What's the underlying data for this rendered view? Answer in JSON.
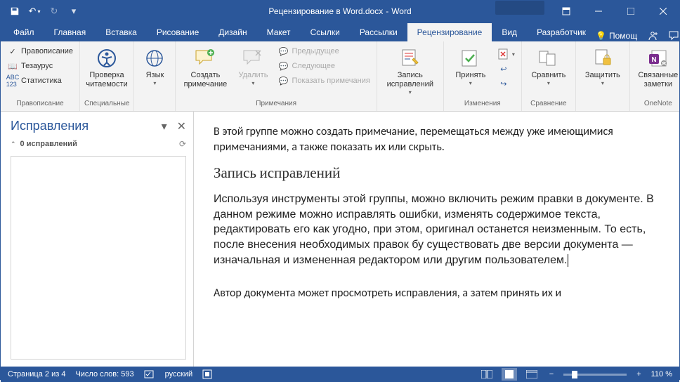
{
  "title": {
    "doc": "Рецензирование в Word.docx",
    "sep": "-",
    "app": "Word"
  },
  "tabs": [
    "Файл",
    "Главная",
    "Вставка",
    "Рисование",
    "Дизайн",
    "Макет",
    "Ссылки",
    "Рассылки",
    "Рецензирование",
    "Вид",
    "Разработчик"
  ],
  "active_tab_index": 8,
  "tell_me": "Помощ",
  "ribbon": {
    "group1": {
      "label": "Правописание",
      "spelling": "Правописание",
      "thesaurus": "Тезаурус",
      "stats": "Статистика"
    },
    "group2": {
      "label": "Специальные",
      "readability": "Проверка читаемости"
    },
    "group3": {
      "label": "",
      "language": "Язык"
    },
    "group4": {
      "label": "Примечания",
      "new_comment": "Создать примечание",
      "delete": "Удалить",
      "prev": "Предыдущее",
      "next": "Следующее",
      "show": "Показать примечания"
    },
    "group5": {
      "label": "",
      "track": "Запись исправлений"
    },
    "group6": {
      "label": "Изменения",
      "accept": "Принять"
    },
    "group7": {
      "label": "Сравнение",
      "compare": "Сравнить"
    },
    "group8": {
      "label": "",
      "protect": "Защитить"
    },
    "group9": {
      "label": "OneNote",
      "onenote": "Связанные заметки"
    }
  },
  "sidebar": {
    "title": "Исправления",
    "subcount": "0 исправлений"
  },
  "document": {
    "p1": "В этой группе можно создать примечание, перемещаться между уже имеющимися примечаниями, а также показать их или скрыть.",
    "h1": "Запись исправлений",
    "p2": "Используя инструменты этой группы, можно включить режим правки в документе. В данном режиме можно исправлять ошибки, изменять содержимое текста, редактировать его как угодно, при этом, оригинал останется неизменным. То есть, после внесения необходимых правок бу существовать две версии документа — изначальная и измененная редактором или другим пользователем.",
    "p3": "Автор документа может просмотреть исправления, а затем принять их и"
  },
  "status": {
    "page": "Страница 2 из 4",
    "words": "Число слов: 593",
    "lang": "русский",
    "zoom": "110 %"
  }
}
